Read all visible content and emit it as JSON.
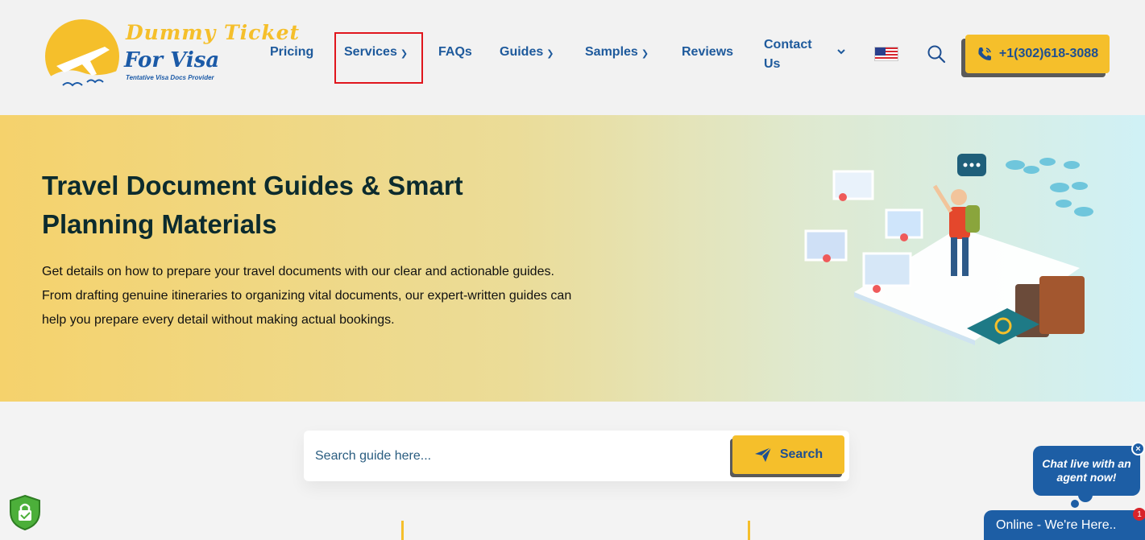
{
  "logo": {
    "line1": "Dummy Ticket",
    "line2": "For Visa",
    "tagline": "Tentative Visa Docs Provider"
  },
  "nav": {
    "pricing": "Pricing",
    "services": "Services",
    "faqs": "FAQs",
    "guides": "Guides",
    "samples": "Samples",
    "reviews": "Reviews",
    "contact_line1": "Contact",
    "contact_line2": "Us",
    "phone": "+1(302)618-3088"
  },
  "hero": {
    "title": "Travel Document Guides & Smart Planning Materials",
    "desc_line1": "Get details on how to prepare your travel documents with our clear and actionable guides.",
    "desc_line2": "From drafting genuine itineraries to organizing vital documents, our expert-written guides can help you prepare every detail without making actual bookings."
  },
  "search": {
    "placeholder": "Search guide here...",
    "button_label": "Search"
  },
  "chat": {
    "bubble": "Chat live with an agent now!",
    "status": "Online - We're Here..",
    "badge_count": "1",
    "close": "×"
  },
  "colors": {
    "accent_yellow": "#f5bf2b",
    "brand_blue": "#1e5a9c",
    "highlight_red": "#e0161d"
  },
  "icons": {
    "search": "magnifier-icon",
    "phone": "phone-icon",
    "send": "paper-plane-icon",
    "lock": "lock-shield-icon",
    "flag": "us-flag-icon"
  }
}
